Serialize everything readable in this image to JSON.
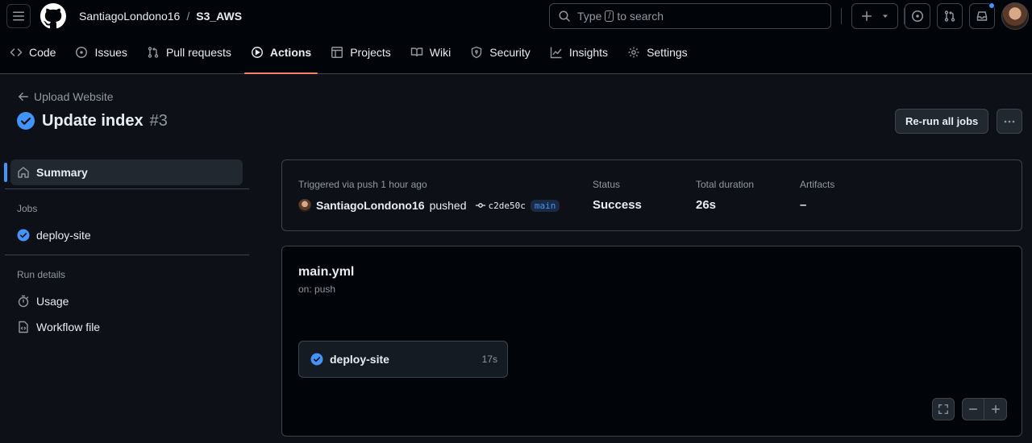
{
  "header": {
    "owner": "SantiagoLondono16",
    "separator": "/",
    "repo": "S3_AWS",
    "search_prefix": "Type",
    "search_key": "/",
    "search_suffix": "to search"
  },
  "tabs": [
    {
      "label": "Code",
      "icon": "code-icon"
    },
    {
      "label": "Issues",
      "icon": "issue-icon"
    },
    {
      "label": "Pull requests",
      "icon": "pull-request-icon"
    },
    {
      "label": "Actions",
      "icon": "play-icon",
      "active": true
    },
    {
      "label": "Projects",
      "icon": "table-icon"
    },
    {
      "label": "Wiki",
      "icon": "book-icon"
    },
    {
      "label": "Security",
      "icon": "shield-icon"
    },
    {
      "label": "Insights",
      "icon": "graph-icon"
    },
    {
      "label": "Settings",
      "icon": "gear-icon"
    }
  ],
  "run": {
    "back_label": "Upload Website",
    "title": "Update index",
    "number": "#3",
    "rerun_label": "Re-run all jobs"
  },
  "sidebar": {
    "summary_label": "Summary",
    "jobs_heading": "Jobs",
    "job_label": "deploy-site",
    "run_details_heading": "Run details",
    "usage_label": "Usage",
    "workflow_file_label": "Workflow file"
  },
  "summary": {
    "trigger_text": "Triggered via push 1 hour ago",
    "actor": "SantiagoLondono16",
    "action": "pushed",
    "commit": "c2de50c",
    "branch": "main",
    "status_label": "Status",
    "status_value": "Success",
    "duration_label": "Total duration",
    "duration_value": "26s",
    "artifacts_label": "Artifacts",
    "artifacts_value": "–"
  },
  "workflow": {
    "file": "main.yml",
    "trigger": "on: push",
    "job_name": "deploy-site",
    "job_duration": "17s"
  },
  "colors": {
    "accent": "#4493f8",
    "tab_underline": "#f78166",
    "background": "#0d1117"
  }
}
